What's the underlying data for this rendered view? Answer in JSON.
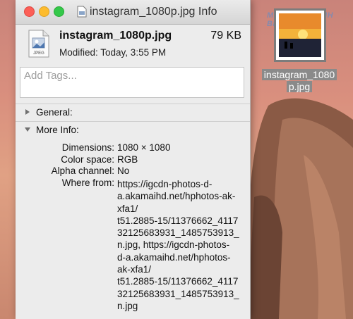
{
  "desktop": {
    "file_label": "instagram_1080p.jpg",
    "file_label_line1": "instagram_1080",
    "file_label_line2": "p.jpg",
    "watermark": "MUABANNHANH BLOG"
  },
  "window": {
    "title": "instagram_1080p.jpg Info",
    "file_name": "instagram_1080p.jpg",
    "file_size": "79 KB",
    "modified": "Modified: Today, 3:55 PM",
    "tags_placeholder": "Add Tags...",
    "icon_type_label": "JPEG"
  },
  "sections": {
    "general": "General:",
    "more_info": "More Info:"
  },
  "more_info": {
    "dimensions_label": "Dimensions:",
    "dimensions_value": "1080 × 1080",
    "color_space_label": "Color space:",
    "color_space_value": "RGB",
    "alpha_label": "Alpha channel:",
    "alpha_value": "No",
    "where_from_label": "Where from:",
    "where_from_lines": [
      "https://igcdn-photos-d-",
      "a.akamaihd.net/hphotos-ak-",
      "xfa1/",
      "t51.2885-15/11376662_4117",
      "32125683931_1485753913_",
      "n.jpg, https://igcdn-photos-",
      "d-a.akamaihd.net/hphotos-",
      "ak-xfa1/",
      "t51.2885-15/11376662_4117",
      "32125683931_1485753913_",
      "n.jpg"
    ]
  }
}
